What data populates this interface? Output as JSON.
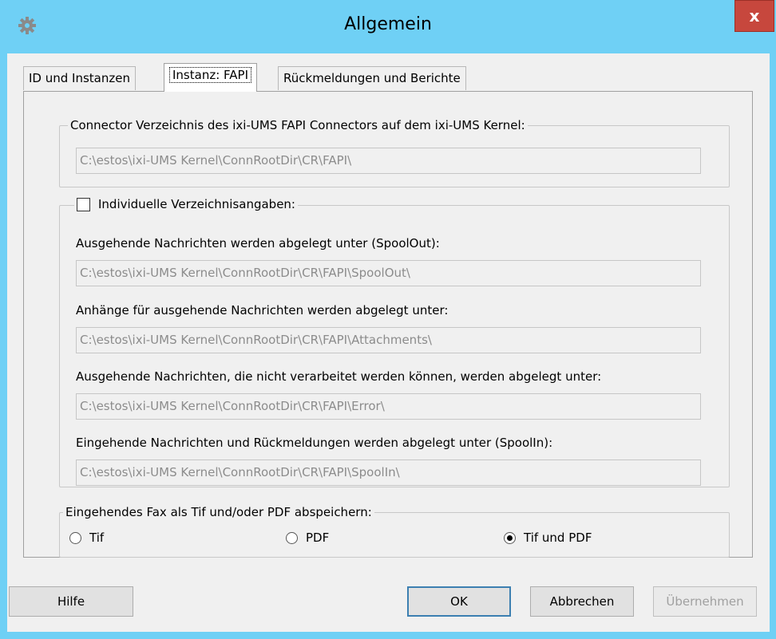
{
  "window": {
    "title": "Allgemein",
    "close_label": "x"
  },
  "tabs": [
    {
      "label": "ID und Instanzen",
      "active": false
    },
    {
      "label": "Instanz: FAPI",
      "active": true
    },
    {
      "label": "Rückmeldungen und Berichte",
      "active": false
    }
  ],
  "connector": {
    "legend": "Connector Verzeichnis des ixi-UMS FAPI Connectors auf dem ixi-UMS Kernel:",
    "path": "C:\\estos\\ixi-UMS Kernel\\ConnRootDir\\CR\\FAPI\\"
  },
  "individual": {
    "checkbox_label": "Individuelle Verzeichnisangaben:",
    "checked": false,
    "fields": [
      {
        "label": "Ausgehende Nachrichten werden abgelegt unter (SpoolOut):",
        "value": "C:\\estos\\ixi-UMS Kernel\\ConnRootDir\\CR\\FAPI\\SpoolOut\\"
      },
      {
        "label": "Anhänge für ausgehende Nachrichten werden abgelegt unter:",
        "value": "C:\\estos\\ixi-UMS Kernel\\ConnRootDir\\CR\\FAPI\\Attachments\\"
      },
      {
        "label": "Ausgehende Nachrichten, die nicht verarbeitet werden können, werden abgelegt unter:",
        "value": "C:\\estos\\ixi-UMS Kernel\\ConnRootDir\\CR\\FAPI\\Error\\"
      },
      {
        "label": "Eingehende Nachrichten und Rückmeldungen werden abgelegt unter (SpoolIn):",
        "value": "C:\\estos\\ixi-UMS Kernel\\ConnRootDir\\CR\\FAPI\\SpoolIn\\"
      }
    ]
  },
  "fax": {
    "legend": "Eingehendes Fax als Tif und/oder PDF abspeichern:",
    "options": [
      {
        "label": "Tif",
        "selected": false
      },
      {
        "label": "PDF",
        "selected": false
      },
      {
        "label": "Tif und PDF",
        "selected": true
      }
    ]
  },
  "buttons": {
    "help": "Hilfe",
    "ok": "OK",
    "cancel": "Abbrechen",
    "apply": "Übernehmen"
  },
  "colors": {
    "title_bar": "#6fd0f5",
    "close_button": "#c7473d",
    "dialog_bg": "#f0f0f0"
  },
  "icons": {
    "title": "gear-icon",
    "close": "close-icon"
  }
}
